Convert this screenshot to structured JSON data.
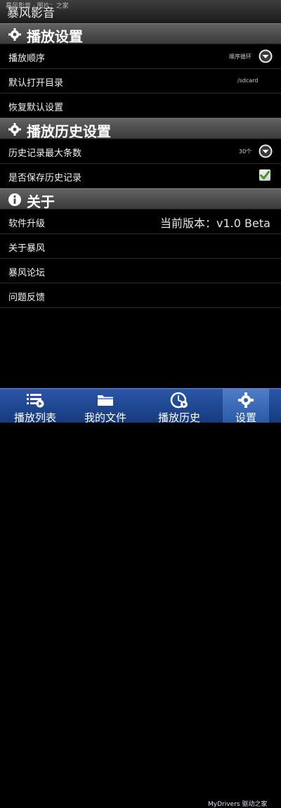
{
  "app": {
    "title": "暴风影音",
    "status_text": "暴风影音 · 图片：之家"
  },
  "sections": {
    "playback": {
      "title": "播放设置",
      "rows": [
        {
          "label": "播放顺序",
          "value": "顺序循环"
        },
        {
          "label": "默认打开目录",
          "value": "/sdcard"
        },
        {
          "label": "恢复默认设置"
        }
      ]
    },
    "history": {
      "title": "播放历史设置",
      "rows": [
        {
          "label": "历史记录最大条数",
          "value": "30个"
        },
        {
          "label": "是否保存历史记录",
          "checked": true
        }
      ]
    },
    "about": {
      "title": "关于",
      "rows": [
        {
          "label": "软件升级",
          "value": "当前版本：v1.0 Beta"
        },
        {
          "label": "关于暴风"
        },
        {
          "label": "暴风论坛"
        },
        {
          "label": "问题反馈"
        }
      ]
    }
  },
  "bottom_nav": {
    "tabs": [
      {
        "label": "播放列表",
        "icon": "playlist-icon"
      },
      {
        "label": "我的文件",
        "icon": "folder-icon"
      },
      {
        "label": "播放历史",
        "icon": "history-clock-icon"
      },
      {
        "label": "设置",
        "icon": "gear-icon",
        "active": true
      }
    ]
  },
  "watermark": "MyDrivers 驱动之家",
  "colors": {
    "header": "#4a4a4a",
    "bottom_bar": "#1f4a99",
    "active_tab": "#3f72c0",
    "checkbox_check": "#3b9a1b"
  }
}
